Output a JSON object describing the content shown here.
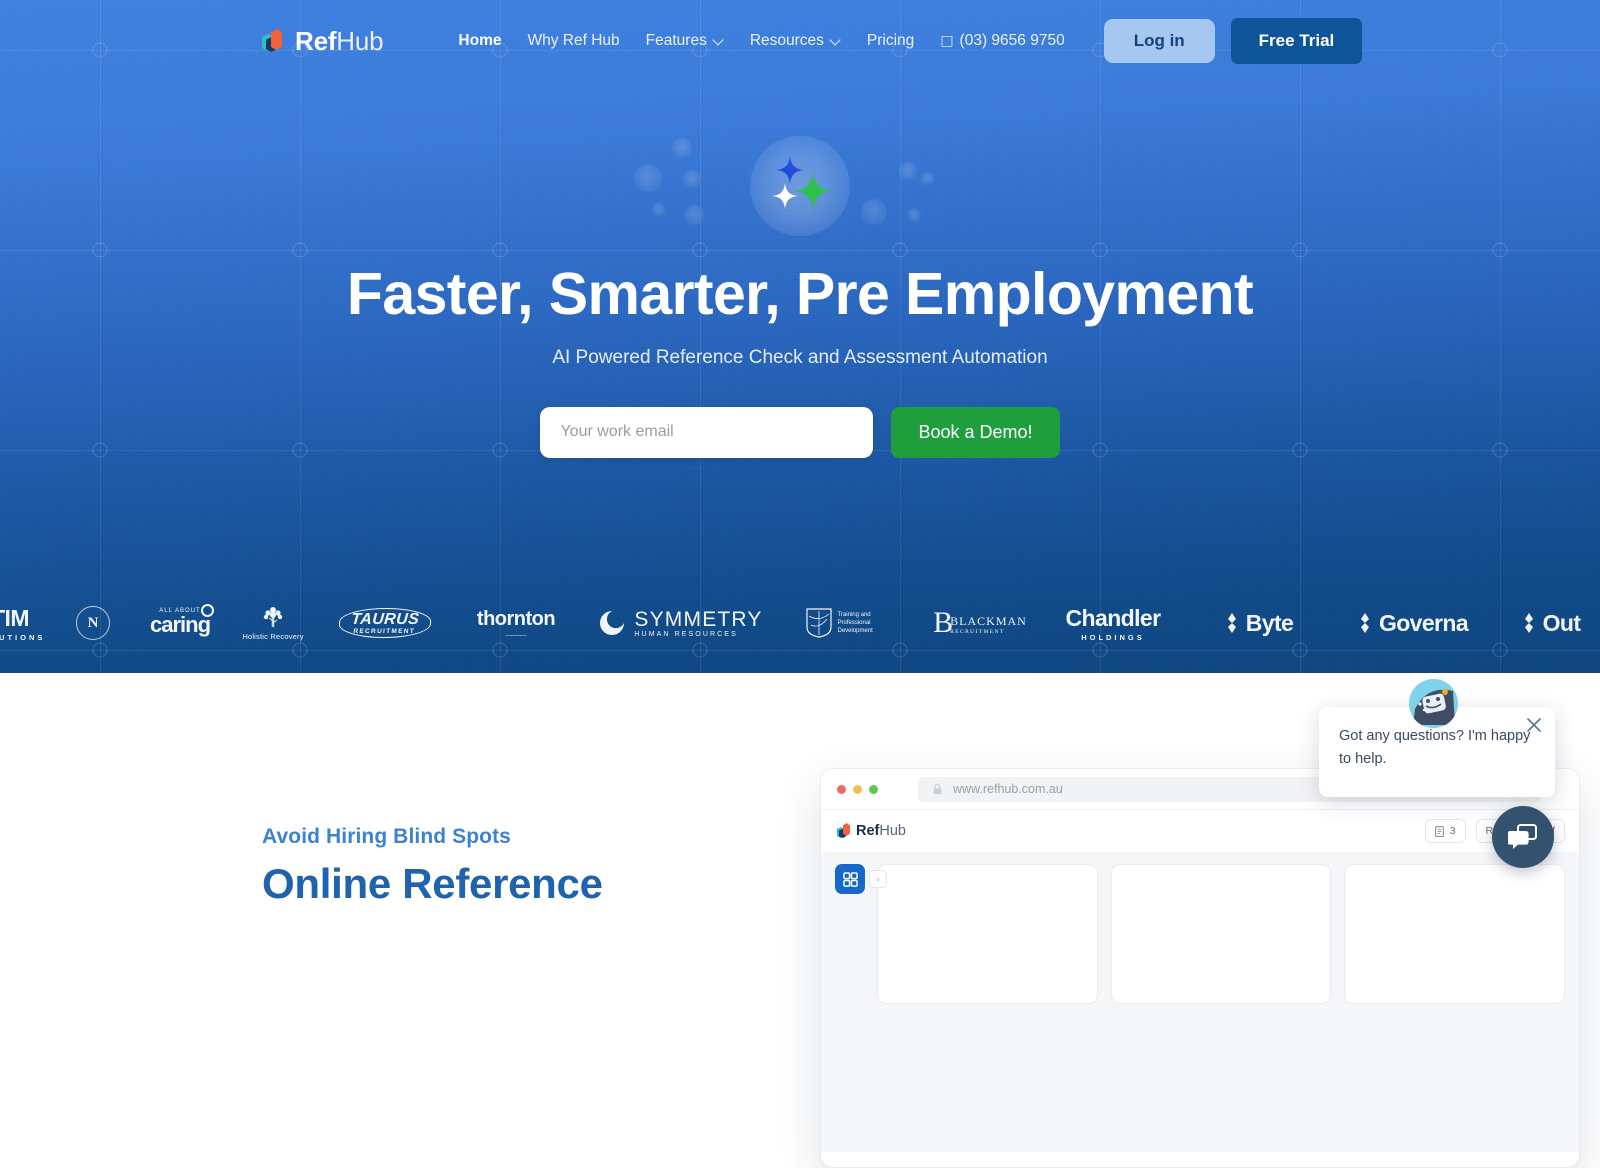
{
  "brand": {
    "part1": "Ref",
    "part2": "Hub",
    "mark_icon": "refhub-cube-logo"
  },
  "nav": {
    "links": [
      {
        "label": "Home",
        "active": true,
        "caret": false,
        "name": "nav-link-home"
      },
      {
        "label": "Why Ref Hub",
        "active": false,
        "caret": false,
        "name": "nav-link-why-ref-hub"
      },
      {
        "label": "Features",
        "active": false,
        "caret": true,
        "name": "nav-link-features"
      },
      {
        "label": "Resources",
        "active": false,
        "caret": true,
        "name": "nav-link-resources"
      },
      {
        "label": "Pricing",
        "active": false,
        "caret": false,
        "name": "nav-link-pricing"
      }
    ],
    "phone_glyph": "□",
    "phone": "(03) 9656 9750",
    "login_label": "Log in",
    "trial_label": "Free Trial"
  },
  "hero": {
    "icon": "sparkles-orb-icon",
    "headline": "Faster, Smarter, Pre Employment",
    "subhead": "AI Powered Reference Check and Assessment Automation",
    "email_placeholder": "Your work email",
    "email_value": "",
    "cta_label": "Book a Demo!",
    "colors": {
      "gradient_top": "#3f81e0",
      "gradient_bottom": "#0e4680",
      "cta_green": "#1f9e3e",
      "login_blue": "#a6c8f0",
      "trial_blue": "#0d5498"
    },
    "sparkles": [
      {
        "name": "sparkle-blue",
        "color": "#1f4fd8"
      },
      {
        "name": "sparkle-green",
        "color": "#2fc04b"
      },
      {
        "name": "sparkle-white",
        "color": "#ffffff"
      }
    ]
  },
  "logos": [
    {
      "name": "logo-tim-solutions",
      "main": "TIM",
      "sub": "SOLUTIONS",
      "style": "bold"
    },
    {
      "name": "logo-n-wellness",
      "main": "N",
      "sub": "",
      "style": "circle"
    },
    {
      "name": "logo-all-about-caring",
      "main": "caring",
      "sub": "ALL ABOUT",
      "style": "script"
    },
    {
      "name": "logo-holistic-recovery",
      "main": "",
      "sub": "Holistic Recovery",
      "style": "tree"
    },
    {
      "name": "logo-taurus-recruitment",
      "main": "TAURUS",
      "sub": "RECRUITMENT",
      "style": "oval"
    },
    {
      "name": "logo-thornton",
      "main": "thornton",
      "sub": "",
      "style": "script"
    },
    {
      "name": "logo-symmetry-hr",
      "main": "SYMMETRY",
      "sub": "HUMAN RESOURCES",
      "style": "swirl"
    },
    {
      "name": "logo-training-professional-development",
      "main": "",
      "sub": "Training and Professional Development",
      "style": "crest"
    },
    {
      "name": "logo-blackman-recruitment",
      "main": "BLACKMAN",
      "sub": "RECRUITMENT",
      "style": "serif"
    },
    {
      "name": "logo-chandler-holdings",
      "main": "Chandler",
      "sub": "HOLDINGS",
      "style": "bold"
    },
    {
      "name": "logo-byte",
      "main": "Byte",
      "sub": "",
      "style": "bold"
    },
    {
      "name": "logo-governa",
      "main": "Governa",
      "sub": "",
      "style": "bold"
    },
    {
      "name": "logo-outl",
      "main": "Out",
      "sub": "",
      "style": "bold"
    }
  ],
  "section": {
    "eyebrow": "Avoid Hiring Blind Spots",
    "title": "Online Reference"
  },
  "mockup": {
    "url": "www.refhub.com.au",
    "lock_icon": "lock-icon",
    "brand_part1": "Ref",
    "brand_part2": "Hub",
    "chips": [
      {
        "icon": "credits-icon",
        "label": "3",
        "name": "chip-credits"
      },
      {
        "icon": "",
        "label": "Remaining Ref",
        "name": "chip-remaining-refs"
      }
    ],
    "rail_icon": "grid-dashboard-icon",
    "rail_expand_icon": "chevron-right-icon",
    "traffic_lights": [
      "#ec6a5e",
      "#f5bf4f",
      "#61c554"
    ]
  },
  "chat": {
    "avatar_icon": "robot-avatar-icon",
    "message": "Got any questions? I'm happy to help.",
    "close_icon": "close-icon",
    "fab_icon": "chat-bubble-icon"
  }
}
